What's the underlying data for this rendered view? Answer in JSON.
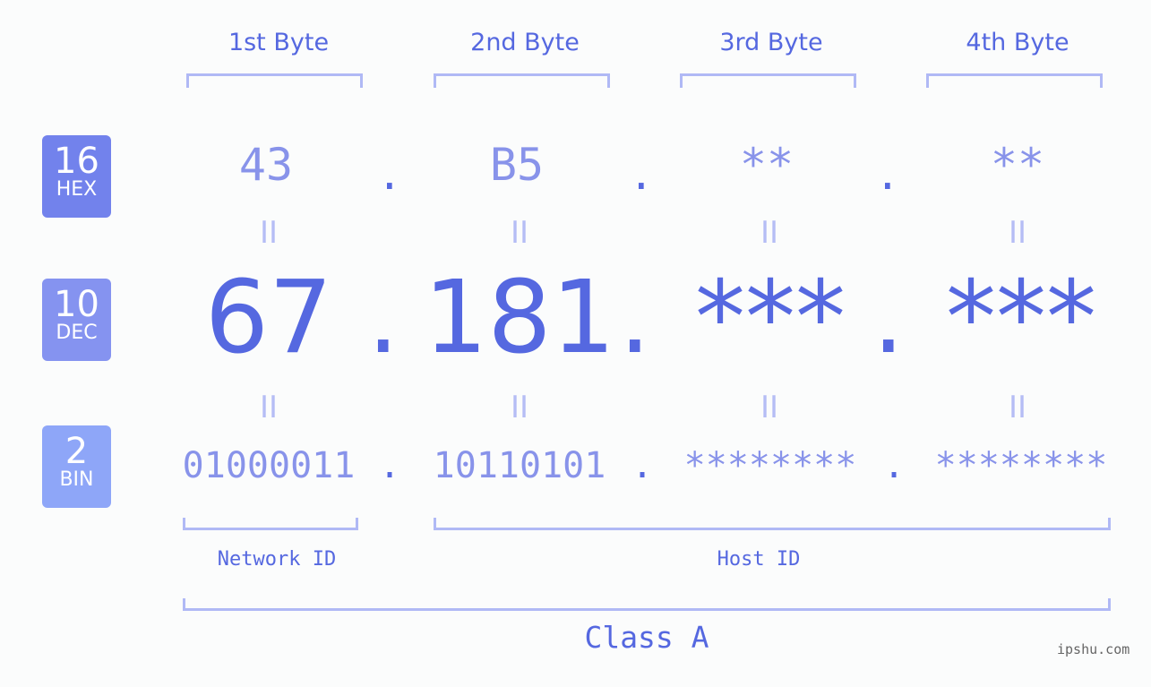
{
  "headers": [
    "1st Byte",
    "2nd Byte",
    "3rd Byte",
    "4th Byte"
  ],
  "badges": [
    {
      "base": "16",
      "label": "HEX",
      "color": "#7282ec"
    },
    {
      "base": "10",
      "label": "DEC",
      "color": "#8593f0"
    },
    {
      "base": "2",
      "label": "BIN",
      "color": "#8ea6f8"
    }
  ],
  "hex": [
    "43",
    "B5",
    "**",
    "**"
  ],
  "dec": [
    "67",
    "181",
    "***",
    "***"
  ],
  "bin": [
    "01000011",
    "10110101",
    "********",
    "********"
  ],
  "separator": ".",
  "equals": "II",
  "network_label": "Network ID",
  "host_label": "Host ID",
  "class_label": "Class A",
  "watermark": "ipshu.com"
}
